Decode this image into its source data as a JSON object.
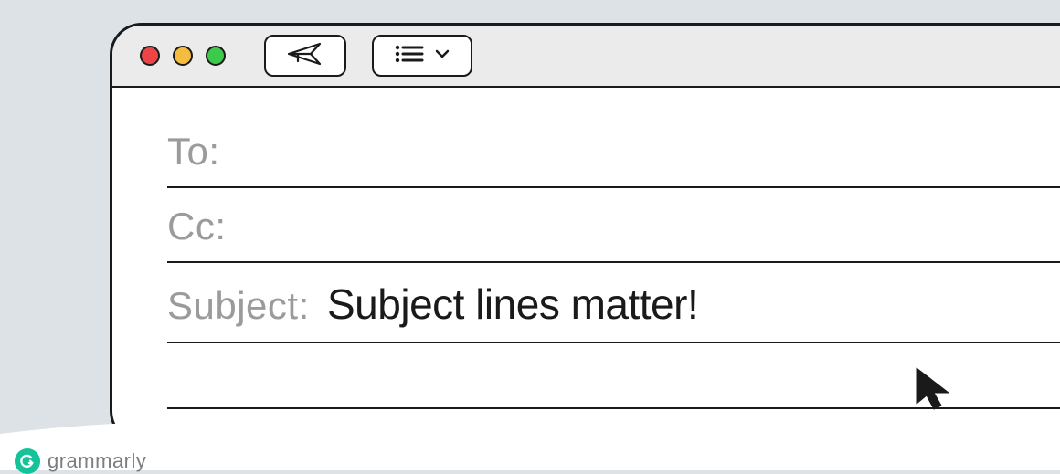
{
  "fields": {
    "to": {
      "label": "To:",
      "value": ""
    },
    "cc": {
      "label": "Cc:",
      "value": ""
    },
    "subject": {
      "label": "Subject:",
      "value": "Subject lines matter!"
    }
  },
  "brand": {
    "name": "grammarly"
  },
  "colors": {
    "red": "#ed4545",
    "yellow": "#f5bd3f",
    "green": "#3dc94a",
    "accent": "#15c39a"
  }
}
